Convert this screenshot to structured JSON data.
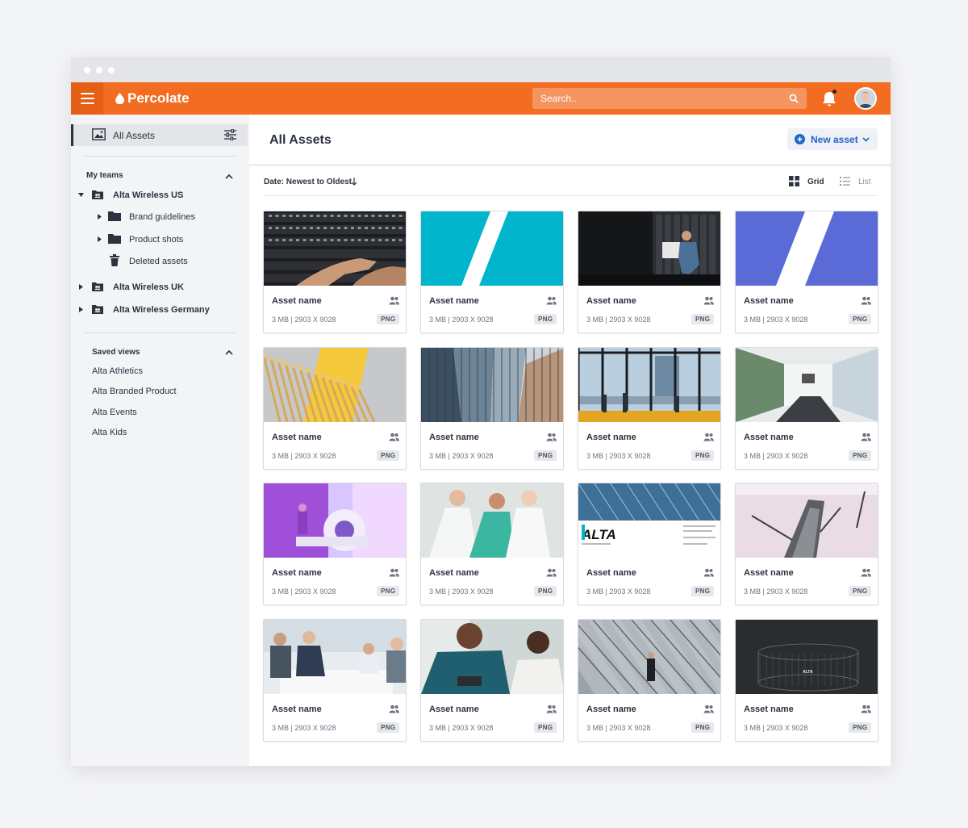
{
  "app": {
    "brand": "Percolate",
    "search_placeholder": "Search..",
    "accent_color": "#f26d21"
  },
  "sidebar": {
    "all_assets_label": "All Assets",
    "my_teams_title": "My teams",
    "teams": [
      {
        "label": "Alta Wireless US",
        "expanded": true
      },
      {
        "label": "Alta Wireless UK",
        "expanded": false
      },
      {
        "label": "Alta Wireless Germany",
        "expanded": false
      }
    ],
    "us_children": [
      {
        "label": "Brand guidelines",
        "icon": "folder-icon"
      },
      {
        "label": "Product shots",
        "icon": "folder-icon"
      },
      {
        "label": "Deleted assets",
        "icon": "trash-icon"
      }
    ],
    "saved_views_title": "Saved views",
    "saved_views": [
      "Alta Athletics",
      "Alta Branded Product",
      "Alta Events",
      "Alta Kids"
    ]
  },
  "main": {
    "title": "All Assets",
    "new_asset_label": "New asset",
    "sort_label": "Date: Newest to Oldest",
    "view_grid_label": "Grid",
    "view_list_label": "List",
    "selected_view": "Grid"
  },
  "assets": [
    {
      "name": "Asset name",
      "meta": "3 MB  |  2903 X 9028",
      "type": "PNG",
      "thumb": "server-hands"
    },
    {
      "name": "Asset name",
      "meta": "3 MB  |  2903 X 9028",
      "type": "PNG",
      "thumb": "teal-stripe"
    },
    {
      "name": "Asset name",
      "meta": "3 MB  |  2903 X 9028",
      "type": "PNG",
      "thumb": "datacenter-man"
    },
    {
      "name": "Asset name",
      "meta": "3 MB  |  2903 X 9028",
      "type": "PNG",
      "thumb": "blue-stripe"
    },
    {
      "name": "Asset name",
      "meta": "3 MB  |  2903 X 9028",
      "type": "PNG",
      "thumb": "yellow-pins"
    },
    {
      "name": "Asset name",
      "meta": "3 MB  |  2903 X 9028",
      "type": "PNG",
      "thumb": "skyscrapers"
    },
    {
      "name": "Asset name",
      "meta": "3 MB  |  2903 X 9028",
      "type": "PNG",
      "thumb": "office-window"
    },
    {
      "name": "Asset name",
      "meta": "3 MB  |  2903 X 9028",
      "type": "PNG",
      "thumb": "conference-room"
    },
    {
      "name": "Asset name",
      "meta": "3 MB  |  2903 X 9028",
      "type": "PNG",
      "thumb": "mri-room"
    },
    {
      "name": "Asset name",
      "meta": "3 MB  |  2903 X 9028",
      "type": "PNG",
      "thumb": "doctors"
    },
    {
      "name": "Asset name",
      "meta": "3 MB  |  2903 X 9028",
      "type": "PNG",
      "thumb": "alta-brochure"
    },
    {
      "name": "Asset name",
      "meta": "3 MB  |  2903 X 9028",
      "type": "PNG",
      "thumb": "ship-aerial"
    },
    {
      "name": "Asset name",
      "meta": "3 MB  |  2903 X 9028",
      "type": "PNG",
      "thumb": "business-meeting"
    },
    {
      "name": "Asset name",
      "meta": "3 MB  |  2903 X 9028",
      "type": "PNG",
      "thumb": "nurse-tablet"
    },
    {
      "name": "Asset name",
      "meta": "3 MB  |  2903 X 9028",
      "type": "PNG",
      "thumb": "glass-building"
    },
    {
      "name": "Asset name",
      "meta": "3 MB  |  2903 X 9028",
      "type": "PNG",
      "thumb": "alta-dark-render"
    }
  ],
  "alta_logo_text": "ALTA"
}
